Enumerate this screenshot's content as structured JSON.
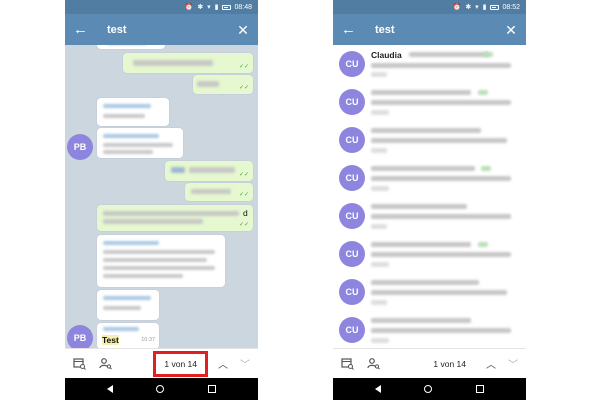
{
  "colors": {
    "header": "#5b8bb4",
    "status": "#517da2",
    "avatar": "#8e86de",
    "highlight": "#e02020"
  },
  "left_screen": {
    "status_time": "08:48",
    "search_query": "test",
    "icons": {
      "back": "back-arrow-icon",
      "close": "close-icon",
      "calendar": "calendar-search-icon",
      "user": "user-search-icon",
      "up": "chevron-up-icon",
      "down": "chevron-down-icon"
    },
    "sender_initials": "PB",
    "sender_initials_2": "PB",
    "partial_text": "d",
    "last_message_text": "Test",
    "last_message_time": "10:37",
    "result_counter": "1 von 14"
  },
  "right_screen": {
    "status_time": "08:52",
    "search_query": "test",
    "first_result_name": "Claudia",
    "results": [
      {
        "initials": "CU"
      },
      {
        "initials": "CU"
      },
      {
        "initials": "CU"
      },
      {
        "initials": "CU"
      },
      {
        "initials": "CU"
      },
      {
        "initials": "CU"
      },
      {
        "initials": "CU"
      },
      {
        "initials": "CU"
      }
    ],
    "result_counter": "1 von 14"
  }
}
